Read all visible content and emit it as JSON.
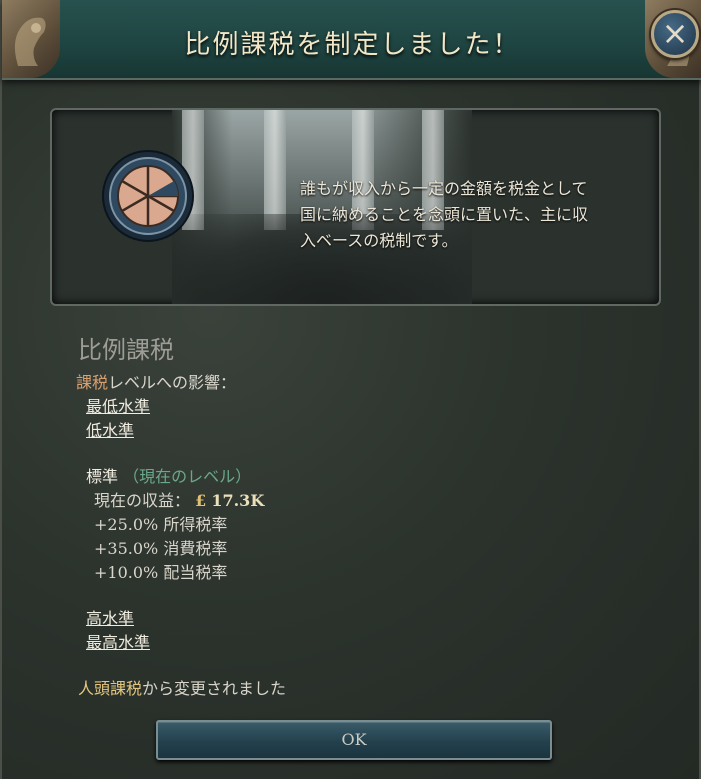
{
  "header": {
    "title": "比例課税を制定しました！"
  },
  "close_icon": "close-icon",
  "banner": {
    "description_lines": [
      "誰もが収入から一定の金額を税金として",
      "国に納めることを念頭に置いた、主に収",
      "入ベースの税制です。"
    ]
  },
  "policy": {
    "name": "比例課税",
    "effect_label_highlight": "課税",
    "effect_label_rest": "レベルへの影響：",
    "levels_above": [
      "最低水準",
      "低水準"
    ],
    "current_level": "標準",
    "current_tag": "（現在のレベル）",
    "income_label": "現在の収益：",
    "income_symbol": "£",
    "income_value": "17.3K",
    "modifiers": [
      "+25.0% 所得税率",
      "+35.0% 消費税率",
      "+10.0% 配当税率"
    ],
    "levels_below": [
      "高水準",
      "最高水準"
    ],
    "changed_from_name": "人頭課税",
    "changed_from_suffix": "から変更されました"
  },
  "buttons": {
    "ok_label": "OK"
  },
  "colors": {
    "header": "#1f4542",
    "highlight": "#d9a070",
    "current_tag": "#6aa889",
    "button": "#23414d"
  }
}
